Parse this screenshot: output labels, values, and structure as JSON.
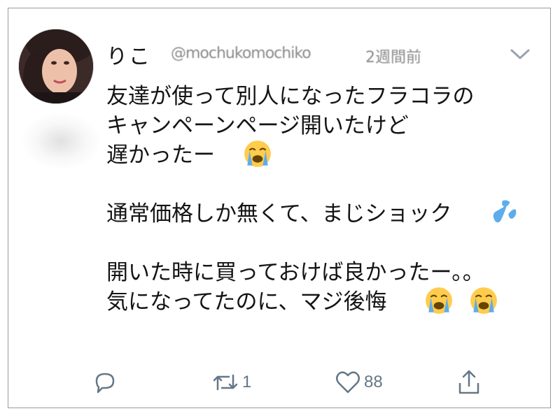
{
  "tweet": {
    "author": {
      "display_name": "りこ",
      "handle": "@mochukomochiko",
      "timestamp": "2週間前",
      "avatar": "profile-photo"
    },
    "lines": [
      "友達が使って別人になったフラコラの",
      "キャンペーンページ開いたけど",
      "遅かったー",
      "",
      "通常価格しか無くて、まじショック",
      "",
      "開いた時に買っておけば良かったー。。",
      "気になってたのに、マジ後悔"
    ],
    "emojis": {
      "line3": [
        "loudly-crying-face"
      ],
      "line5": [
        "sweat-droplets"
      ],
      "line8": [
        "loudly-crying-face",
        "loudly-crying-face"
      ]
    },
    "actions": {
      "reply_icon": "reply-icon",
      "retweet_icon": "retweet-icon",
      "retweet_count": "1",
      "like_icon": "heart-icon",
      "like_count": "88",
      "share_icon": "share-icon"
    },
    "colors": {
      "icon_gray": "#657786",
      "emoji_yellow": "#ffcc4d",
      "tear_blue": "#5dadec"
    }
  }
}
